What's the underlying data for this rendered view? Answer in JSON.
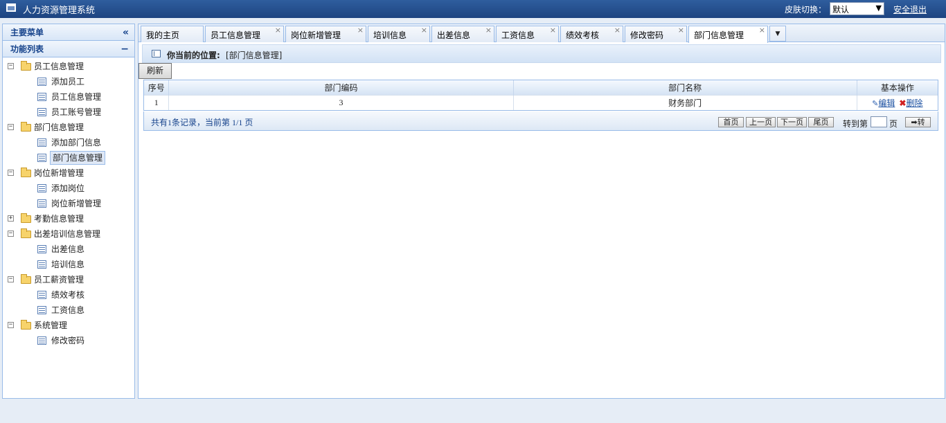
{
  "app": {
    "title": "人力资源管理系统"
  },
  "header": {
    "skin_label": "皮肤切换：",
    "skin_value": "默认",
    "logout": "安全退出"
  },
  "sidebar": {
    "title": "主要菜单",
    "subtitle": "功能列表",
    "groups": [
      {
        "label": "员工信息管理",
        "items": [
          "添加员工",
          "员工信息管理",
          "员工账号管理"
        ]
      },
      {
        "label": "部门信息管理",
        "items": [
          "添加部门信息",
          "部门信息管理"
        ]
      },
      {
        "label": "岗位新增管理",
        "items": [
          "添加岗位",
          "岗位新增管理"
        ]
      },
      {
        "label": "考勤信息管理",
        "items": []
      },
      {
        "label": "出差培训信息管理",
        "items": [
          "出差信息",
          "培训信息"
        ]
      },
      {
        "label": "员工薪资管理",
        "items": [
          "绩效考核",
          "工资信息"
        ]
      },
      {
        "label": "系统管理",
        "items": [
          "修改密码"
        ]
      }
    ],
    "selected": "部门信息管理"
  },
  "tabs": [
    "我的主页",
    "员工信息管理",
    "岗位新增管理",
    "培训信息",
    "出差信息",
    "工资信息",
    "绩效考核",
    "修改密码",
    "部门信息管理"
  ],
  "location": {
    "label": "你当前的位置:",
    "value": "[部门信息管理]"
  },
  "toolbar": {
    "refresh": "刷新"
  },
  "grid": {
    "columns": [
      "序号",
      "部门编码",
      "部门名称",
      "基本操作"
    ],
    "rows": [
      {
        "index": "1",
        "code": "3",
        "name": "财务部门",
        "edit": "编辑",
        "delete": "删除"
      }
    ]
  },
  "pager": {
    "summary": "共有1条记录，当前第 1/1 页",
    "first": "首页",
    "prev": "上一页",
    "next": "下一页",
    "last": "尾页",
    "goto_label": "转到第",
    "page_unit": "页",
    "go": "➡转"
  }
}
